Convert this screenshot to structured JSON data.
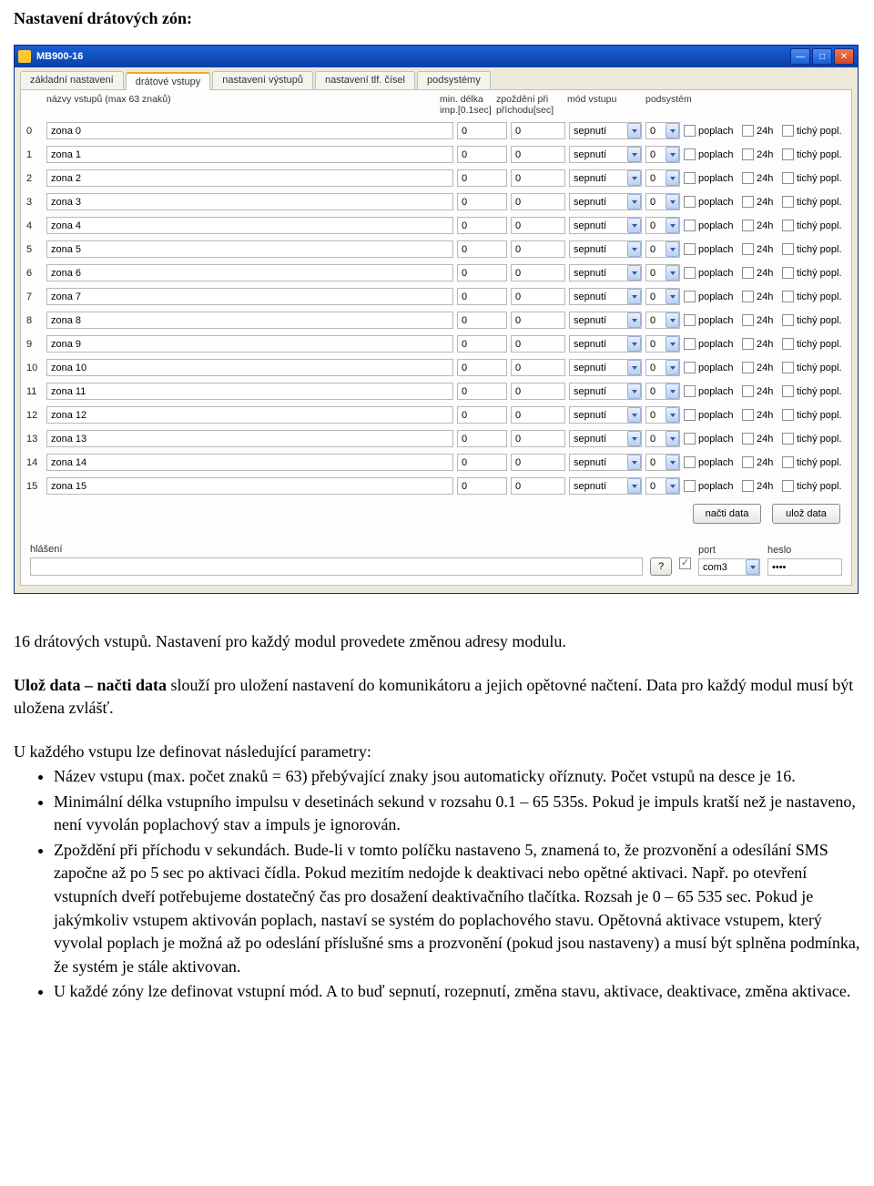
{
  "doc": {
    "heading": "Nastavení drátových zón:",
    "para1": "16 drátových vstupů. Nastavení pro každý modul provedete změnou adresy modulu.",
    "para2a": "Ulož data – načti data",
    "para2b": " slouží pro uložení nastavení do komunikátoru a jejich opětovné načtení. Data pro každý modul musí být uložena zvlášť.",
    "para3": "U každého vstupu lze definovat následující parametry:",
    "bullets": [
      "Název vstupu (max. počet znaků = 63) přebývající znaky jsou automaticky oříznuty. Počet vstupů na desce je 16.",
      "Minimální délka vstupního impulsu v desetinách sekund v rozsahu 0.1 – 65 535s. Pokud je impuls kratší než je nastaveno, není vyvolán poplachový stav a impuls je ignorován.",
      "Zpoždění při příchodu v sekundách. Bude-li v tomto políčku nastaveno 5, znamená to, že prozvonění a odesílání SMS započne až po 5 sec po aktivaci čídla. Pokud mezitím nedojde k deaktivaci nebo opětné aktivaci. Např. po otevření vstupních dveří potřebujeme dostatečný čas pro dosažení deaktivačního tlačítka. Rozsah je 0 – 65 535 sec.  Pokud je jakýmkoliv vstupem aktivován poplach, nastaví se systém do poplachového stavu. Opětovná aktivace vstupem, který vyvolal poplach je možná až po odeslání příslušné sms a prozvonění (pokud jsou nastaveny) a musí být splněna podmínka, že systém je stále aktivovan.",
      "U každé zóny lze definovat vstupní mód. A to buď  sepnutí, rozepnutí, změna stavu, aktivace, deaktivace, změna aktivace."
    ]
  },
  "window": {
    "title": "MB900-16",
    "tabs": [
      "základní nastavení",
      "drátové vstupy",
      "nastavení výstupů",
      "nastavení tlf. čísel",
      "podsystémy"
    ],
    "activeTab": 1,
    "headers": {
      "name": "názvy vstupů (max 63 znaků)",
      "min": "min. délka imp.[0.1sec]",
      "delay": "zpoždění při příchodu[sec]",
      "mode": "mód vstupu",
      "sub": "podsystém",
      "c1": "poplach",
      "c2": "24h",
      "c3": "tichý popl."
    },
    "defaults": {
      "min": "0",
      "delay": "0",
      "mode": "sepnutí",
      "sub": "0"
    },
    "zoneNamePrefix": "zona ",
    "zoneCount": 16,
    "buttons": {
      "load": "načti data",
      "save": "ulož data"
    },
    "bottom": {
      "hlaseni_lbl": "hlášení",
      "hlaseni_val": "",
      "port_lbl": "port",
      "port_val": "com3",
      "heslo_lbl": "heslo",
      "heslo_val": "••••",
      "question": "?"
    }
  }
}
